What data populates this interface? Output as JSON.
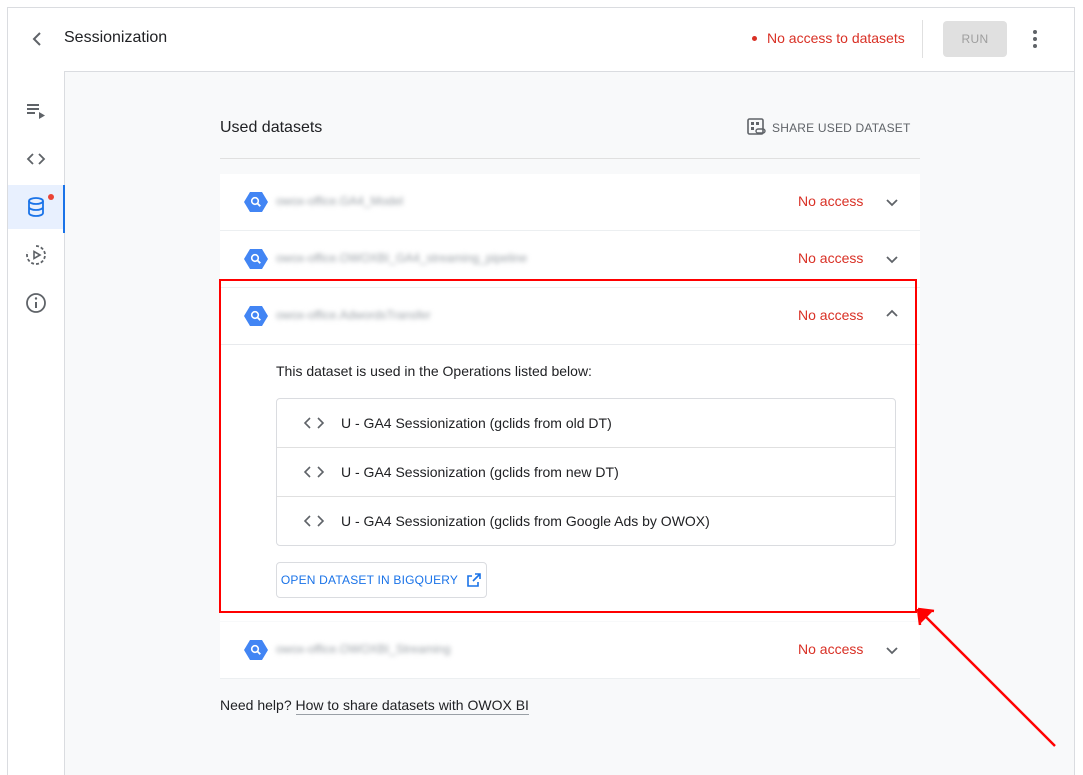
{
  "header": {
    "title": "Sessionization",
    "status": "No access to datasets",
    "run_label": "RUN"
  },
  "sidebar": {
    "items": [
      {
        "icon": "playlist-icon"
      },
      {
        "icon": "code-icon"
      },
      {
        "icon": "database-icon",
        "active": true,
        "badge": true
      },
      {
        "icon": "schedule-icon"
      },
      {
        "icon": "info-icon"
      }
    ]
  },
  "main": {
    "section_title": "Used datasets",
    "share_label": "SHARE USED DATASET",
    "datasets": [
      {
        "name": "owox-office.GA4_Model",
        "access": "No access",
        "expanded": false
      },
      {
        "name": "owox-office.OWOXBI_GA4_streaming_pipeline",
        "access": "No access",
        "expanded": false
      },
      {
        "name": "owox-office.AdwordsTransfer",
        "access": "No access",
        "expanded": true
      },
      {
        "name": "owox-office.OWOXBI_Streaming",
        "access": "No access",
        "expanded": false
      }
    ],
    "expanded_panel": {
      "used_text": "This dataset is used in the Operations listed below:",
      "operations": [
        "U - GA4 Sessionization (gclids from old DT)",
        "U - GA4 Sessionization (gclids from new DT)",
        "U - GA4 Sessionization (gclids from Google Ads by OWOX)"
      ],
      "open_button": "OPEN DATASET IN BIGQUERY"
    },
    "help_text": "Need help?",
    "help_link": "How to share datasets with OWOX BI"
  },
  "colors": {
    "accent": "#1a73e8",
    "error": "#d93025",
    "annotation": "#ff0000"
  }
}
